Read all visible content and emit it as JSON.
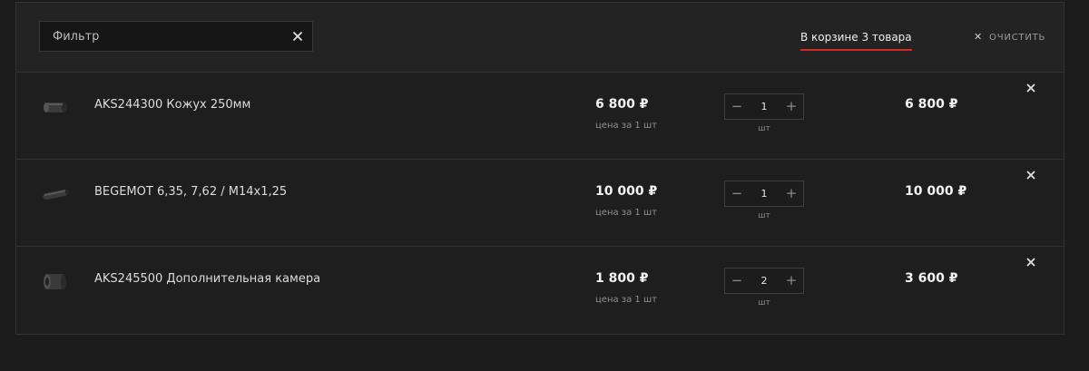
{
  "filter": {
    "placeholder": "Фильтр",
    "value": ""
  },
  "header": {
    "count_text": "В корзине 3 товара",
    "clear_label": "очистить",
    "accent": "#d22a2a"
  },
  "items": [
    {
      "name": "AKS244300 Кожух 250мм",
      "price": "6 800 ₽",
      "price_note": "цена за 1 шт",
      "qty": "1",
      "unit": "шт",
      "total": "6 800 ₽",
      "icon": "cover-tube-icon"
    },
    {
      "name": "BEGEMOT 6,35, 7,62 / M14x1,25",
      "price": "10 000 ₽",
      "price_note": "цена за 1 шт",
      "qty": "1",
      "unit": "шт",
      "total": "10 000 ₽",
      "icon": "suppressor-icon"
    },
    {
      "name": "AKS245500 Дополнительная камера",
      "price": "1 800 ₽",
      "price_note": "цена за 1 шт",
      "qty": "2",
      "unit": "шт",
      "total": "3 600 ₽",
      "icon": "chamber-icon"
    }
  ]
}
